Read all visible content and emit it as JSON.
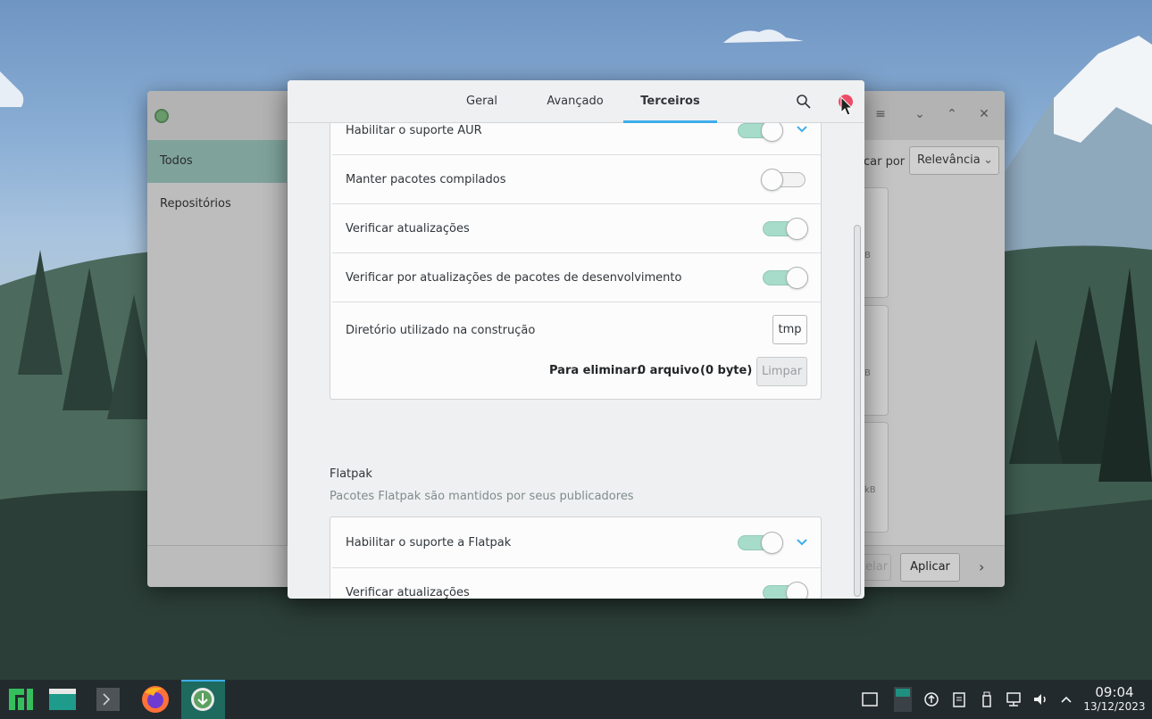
{
  "background_window": {
    "sidebar": [
      "Todos",
      "Repositórios"
    ],
    "sort_label": "car por",
    "sort_value": "Relevância",
    "card_sizes": [
      "B",
      "B",
      "kB"
    ],
    "cancel_label": "celar",
    "apply_label": "Aplicar"
  },
  "dialog": {
    "tabs": [
      {
        "label": "Geral",
        "active": false
      },
      {
        "label": "Avançado",
        "active": false
      },
      {
        "label": "Terceiros",
        "active": true
      }
    ]
  },
  "aur": {
    "rows": [
      {
        "label": "Habilitar o suporte AUR",
        "on": true,
        "expander": true
      },
      {
        "label": "Manter pacotes compilados",
        "on": false
      },
      {
        "label": "Verificar atualizações",
        "on": true
      },
      {
        "label": "Verificar por atualizações de pacotes de desenvolvimento",
        "on": true
      }
    ],
    "build_dir_label": "Diretório utilizado na construção",
    "build_dir_value": "tmp",
    "to_remove_label": "Para eliminar:",
    "to_remove_count": "0 arquivo",
    "to_remove_size": "(0 byte)",
    "clean_label": "Limpar"
  },
  "flatpak": {
    "title": "Flatpak",
    "subtitle": "Pacotes Flatpak são mantidos por seus publicadores",
    "rows": [
      {
        "label": "Habilitar o suporte a Flatpak",
        "on": true,
        "expander": true
      },
      {
        "label": "Verificar atualizações",
        "on": true
      }
    ]
  },
  "taskbar": {
    "time": "09:04",
    "date": "13/12/2023"
  },
  "colors": {
    "accent": "#3daee9",
    "switch_on": "#a7dccb",
    "close": "#ed4c67"
  }
}
